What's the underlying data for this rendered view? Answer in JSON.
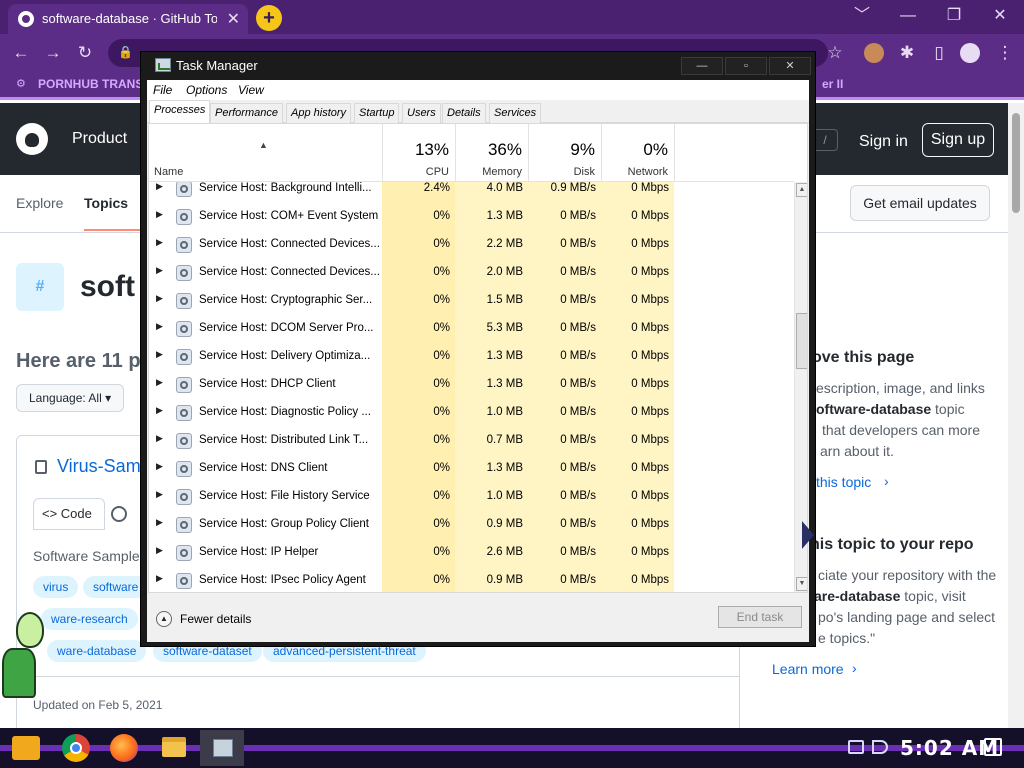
{
  "browser": {
    "tab_title": "software-database · GitHub To",
    "tab_close": "✕",
    "new_tab": "+",
    "window_controls": [
      "﹀",
      "—",
      "❐",
      "✕"
    ],
    "bookmark_1": "PORNHUB TRANS",
    "bookmark_2": "er II"
  },
  "github": {
    "nav_product": "Product",
    "search_slash": "/",
    "sign_in": "Sign in",
    "sign_up": "Sign up",
    "explore": "Explore",
    "topics": "Topics",
    "email_updates": "Get email updates",
    "topic_hash": "#",
    "topic_title": "soft",
    "here_are": "Here are 11 p",
    "language": "Language: All ▾",
    "repo_name": "Virus-Sam",
    "code_tab": "<> Code",
    "repo_desc": "Software Sample",
    "tags": [
      "virus",
      "software",
      "ware-research",
      "ware-database",
      "software-dataset",
      "advanced-persistent-threat"
    ],
    "updated": "Updated on Feb 5, 2021",
    "sidebar": {
      "improve_heading": "ove this page",
      "improve_line1": "escription, image, and links",
      "improve_line2_bold": "oftware-database",
      "improve_line2_rest": " topic",
      "improve_line3": "that developers can more",
      "improve_line4": "arn about it.",
      "curate_link": "this topic",
      "add_heading": "his topic to your repo",
      "add_line1": "ciate your repository with the",
      "add_line2_bold": "are-database",
      "add_line2_rest": " topic, visit",
      "add_line3": "po's landing page and select",
      "add_line4": "e topics.\"",
      "learn_more": "Learn more"
    }
  },
  "task_manager": {
    "title": "Task Manager",
    "window_controls": [
      "—",
      "▫",
      "✕"
    ],
    "menu": [
      "File",
      "Options",
      "View"
    ],
    "tabs": [
      "Processes",
      "Performance",
      "App history",
      "Startup",
      "Users",
      "Details",
      "Services"
    ],
    "active_tab": "Processes",
    "sort_arrow": "▲",
    "columns": {
      "name": "Name",
      "cpu": {
        "label": "CPU",
        "pct": "13%"
      },
      "memory": {
        "label": "Memory",
        "pct": "36%"
      },
      "disk": {
        "label": "Disk",
        "pct": "9%"
      },
      "network": {
        "label": "Network",
        "pct": "0%"
      }
    },
    "rows": [
      {
        "name": "Service Host: Background Intelli...",
        "cpu": "2.4%",
        "mem": "4.0 MB",
        "disk": "0.9 MB/s",
        "net": "0 Mbps"
      },
      {
        "name": "Service Host: COM+ Event System",
        "cpu": "0%",
        "mem": "1.3 MB",
        "disk": "0 MB/s",
        "net": "0 Mbps"
      },
      {
        "name": "Service Host: Connected Devices...",
        "cpu": "0%",
        "mem": "2.2 MB",
        "disk": "0 MB/s",
        "net": "0 Mbps"
      },
      {
        "name": "Service Host: Connected Devices...",
        "cpu": "0%",
        "mem": "2.0 MB",
        "disk": "0 MB/s",
        "net": "0 Mbps"
      },
      {
        "name": "Service Host: Cryptographic Ser...",
        "cpu": "0%",
        "mem": "1.5 MB",
        "disk": "0 MB/s",
        "net": "0 Mbps"
      },
      {
        "name": "Service Host: DCOM Server Pro...",
        "cpu": "0%",
        "mem": "5.3 MB",
        "disk": "0 MB/s",
        "net": "0 Mbps"
      },
      {
        "name": "Service Host: Delivery Optimiza...",
        "cpu": "0%",
        "mem": "1.3 MB",
        "disk": "0 MB/s",
        "net": "0 Mbps"
      },
      {
        "name": "Service Host: DHCP Client",
        "cpu": "0%",
        "mem": "1.3 MB",
        "disk": "0 MB/s",
        "net": "0 Mbps"
      },
      {
        "name": "Service Host: Diagnostic Policy ...",
        "cpu": "0%",
        "mem": "1.0 MB",
        "disk": "0 MB/s",
        "net": "0 Mbps"
      },
      {
        "name": "Service Host: Distributed Link T...",
        "cpu": "0%",
        "mem": "0.7 MB",
        "disk": "0 MB/s",
        "net": "0 Mbps"
      },
      {
        "name": "Service Host: DNS Client",
        "cpu": "0%",
        "mem": "1.3 MB",
        "disk": "0 MB/s",
        "net": "0 Mbps"
      },
      {
        "name": "Service Host: File History Service",
        "cpu": "0%",
        "mem": "1.0 MB",
        "disk": "0 MB/s",
        "net": "0 Mbps"
      },
      {
        "name": "Service Host: Group Policy Client",
        "cpu": "0%",
        "mem": "0.9 MB",
        "disk": "0 MB/s",
        "net": "0 Mbps"
      },
      {
        "name": "Service Host: IP Helper",
        "cpu": "0%",
        "mem": "2.6 MB",
        "disk": "0 MB/s",
        "net": "0 Mbps"
      },
      {
        "name": "Service Host: IPsec Policy Agent",
        "cpu": "0%",
        "mem": "0.9 MB",
        "disk": "0 MB/s",
        "net": "0 Mbps"
      }
    ],
    "fewer_details": "Fewer details",
    "end_task": "End task"
  },
  "taskbar": {
    "clock": "5:02 AM"
  }
}
